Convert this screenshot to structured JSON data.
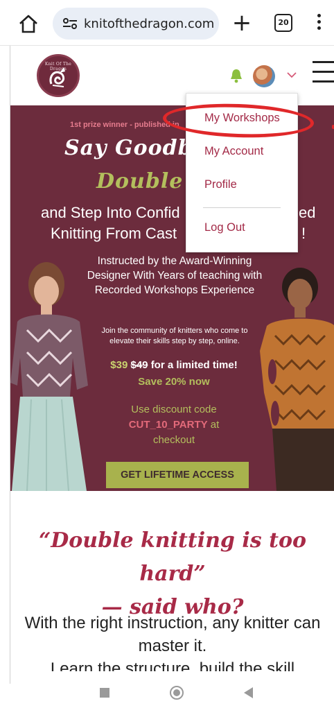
{
  "browser": {
    "url": "knitofthedragon.com",
    "tab_count": "20",
    "plus": "+"
  },
  "site": {
    "logo_text": "Knit Of The Dragon"
  },
  "hero": {
    "prize": "1st prize winner - published in",
    "script1": "Say Goodbye",
    "script2": "Double K",
    "subtitle1": "and Step Into Confid",
    "subtitle1_tail": "ed",
    "subtitle2": "Knitting From Cast",
    "subtitle2_tail": "!",
    "instructed": "Instructed by the Award-Winning Designer With Years of teaching with Recorded Workshops Experience",
    "community": "Join the community of knitters who come to elevate their skills step by step, online.",
    "price_now": "$39",
    "price_old": "$49",
    "price_tail": "for a limited time!",
    "save": "Save 20% now",
    "discount_prefix": "Use discount code",
    "discount_code": "CUT_10_PARTY",
    "discount_at": "at",
    "discount_suffix": "checkout",
    "cta": "GET LIFETIME ACCESS"
  },
  "dropdown": {
    "items": [
      "My Workshops",
      "My Account",
      "Profile",
      "Log Out"
    ]
  },
  "body": {
    "quote_line1": "“Double knitting is too hard”",
    "quote_line2": "— said who?",
    "text": "With the right instruction, any knitter can master it.",
    "text_cut": "Learn the structure, build the skill"
  },
  "colors": {
    "brand_wine": "#6c2c3d",
    "accent_olive": "#a8b24d",
    "link_red": "#a32a47",
    "annotation_red": "#e0282a"
  }
}
